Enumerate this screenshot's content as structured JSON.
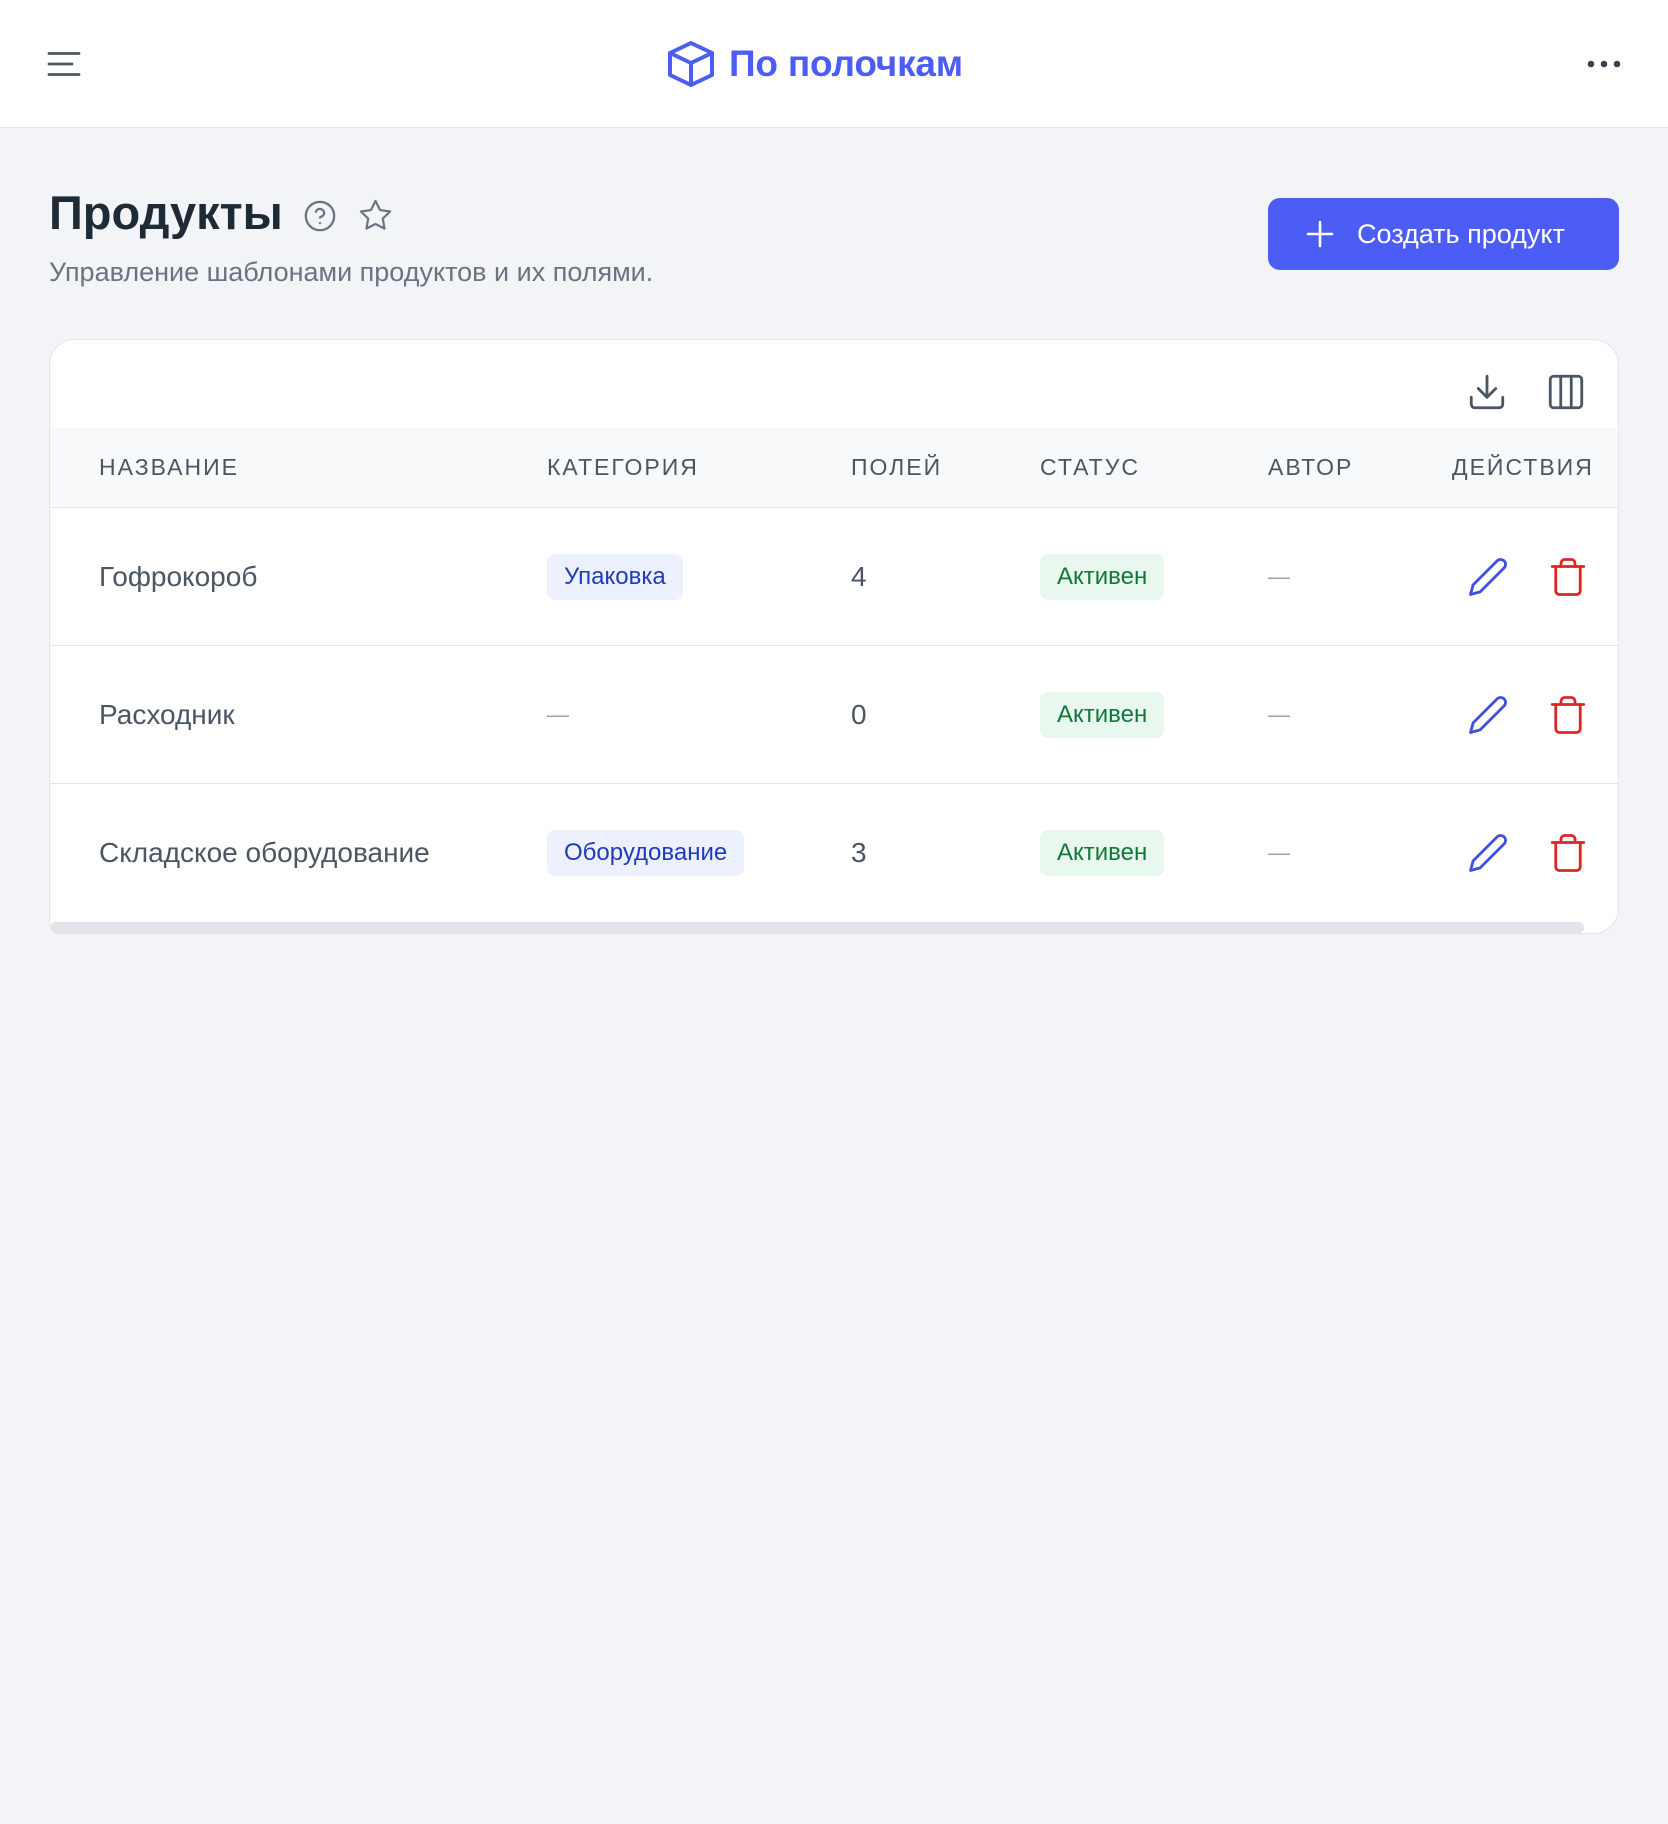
{
  "header": {
    "brand": "По полочкам",
    "icons": {
      "menu": "menu-icon",
      "logo": "cube-icon",
      "more": "more-horizontal-icon"
    }
  },
  "page": {
    "title": "Продукты",
    "subtitle": "Управление шаблонами продуктов и их полями.",
    "icons": {
      "help": "help-circle-icon",
      "favorite": "star-icon"
    },
    "create_button": {
      "label": "Создать продукт",
      "icon": "plus-icon"
    }
  },
  "table": {
    "toolbar": {
      "icons": {
        "export": "download-icon",
        "columns": "columns-icon"
      }
    },
    "columns": [
      "НАЗВАНИЕ",
      "КАТЕГОРИЯ",
      "ПОЛЕЙ",
      "СТАТУС",
      "АВТОР",
      "ДЕЙСТВИЯ"
    ],
    "rows": [
      {
        "name": "Гофрокороб",
        "category": "Упаковка",
        "fields": 4,
        "status": "Активен",
        "author": "—"
      },
      {
        "name": "Расходник",
        "category": "—",
        "fields": 0,
        "status": "Активен",
        "author": "—"
      },
      {
        "name": "Складское оборудование",
        "category": "Оборудование",
        "fields": 3,
        "status": "Активен",
        "author": "—"
      }
    ],
    "row_action_icons": {
      "edit": "pencil-icon",
      "delete": "trash-icon"
    }
  },
  "colors": {
    "primary": "#4c5df6",
    "page_background": "#f3f4f8",
    "edit_action": "#3f4fe0",
    "delete_action": "#dc2626",
    "category_badge_background": "#edf1fd",
    "category_badge_text": "#1f3bbd",
    "status_active_background": "#e8f8ee",
    "status_active_text": "#11783a"
  }
}
